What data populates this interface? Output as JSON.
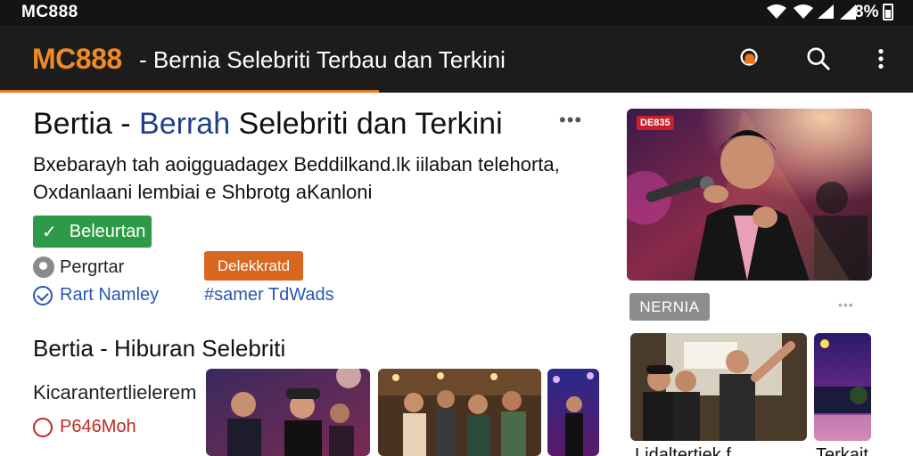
{
  "status_bar": {
    "carrier": "MC888",
    "battery": "8%"
  },
  "app_bar": {
    "brand": "MC888",
    "title": "- Bernia Selebriti Terbau dan Terkini",
    "icons": [
      "notification-icon",
      "search-icon",
      "more-vert-icon"
    ]
  },
  "article": {
    "headline_pre": "Bertia - ",
    "headline_blue": "Berrah",
    "headline_post": " Selebriti dan Terkini",
    "more": "•••",
    "desc_line1": "Bxebarayh tah aoigguadagex Beddilkand.lk iilaban telehorta,",
    "desc_line2": "Oxdanlaani lembiai e Shbrotg aKanloni",
    "green_button": "Beleurtan",
    "author": "Pergrtar",
    "orange_button": "Delekkratd",
    "verified": "Rart Namley",
    "tag_link": "#samer TdWads"
  },
  "section": {
    "title": "Bertia - Hiburan Selebriti",
    "subtitle": "Kicarantertlielerem",
    "live": "P646Moh"
  },
  "sidebar": {
    "hero_badge": "DE835",
    "tag": "NERNIA",
    "more": "•••",
    "bottom_left": "Lidaltertiek  f",
    "bottom_right": "Terkait"
  },
  "colors": {
    "brand_orange": "#f08a24",
    "app_bar_bg": "#1c1c1c",
    "green": "#2e9a47",
    "orange": "#d9671f",
    "link_blue": "#2a57b5"
  }
}
